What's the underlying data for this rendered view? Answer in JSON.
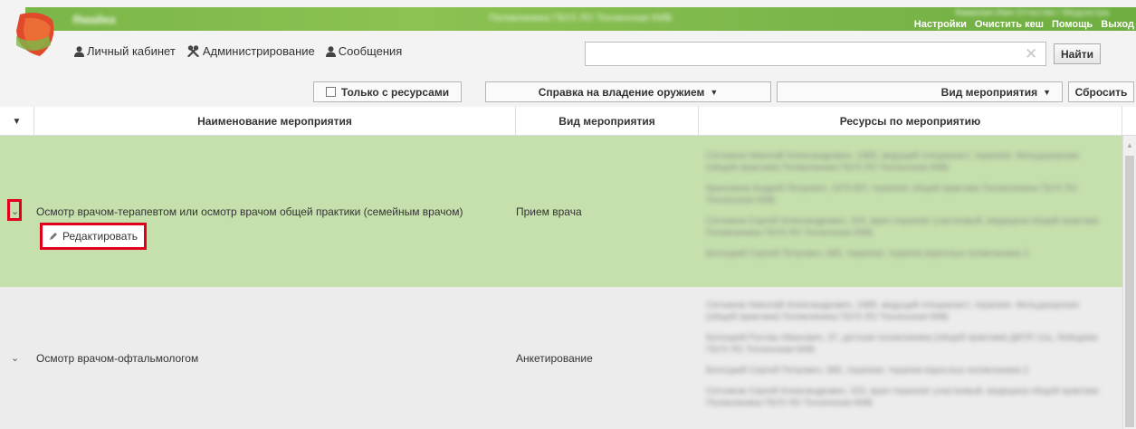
{
  "header": {
    "brand_blurred": "Ямайка",
    "center_blurred": "Поликлиника ГБУЗ ЛО Тосненская КМБ",
    "user_blurred": "Фамилия Имя Отчество / Медсестра",
    "links": [
      "Настройки",
      "Очистить кеш",
      "Помощь",
      "Выход"
    ]
  },
  "nav": {
    "cabinet": "Личный кабинет",
    "admin": "Администрирование",
    "messages": "Сообщения"
  },
  "search": {
    "value": "",
    "placeholder": "",
    "button": "Найти"
  },
  "filters": {
    "resources_only": "Только с ресурсами",
    "certificate": "Справка на владение оружием",
    "event_type": "Вид мероприятия",
    "reset": "Сбросить"
  },
  "table": {
    "columns": [
      "Наименование мероприятия",
      "Вид мероприятия",
      "Ресурсы по мероприятию"
    ],
    "rows": [
      {
        "name": "Осмотр врачом-терапевтом или осмотр врачом общей практики (семейным врачом)",
        "type": "Прием врача",
        "edit_label": "Редактировать",
        "resources_blurred": [
          "Ситников Николай Александрович, 1985, ведущий специалист, терапевт. Фельдшерская (общей практики) Поликлиника ГБУЗ ЛО Тосненская КМБ",
          "Красников Андрей Петрович, 1970 ВП, терапевт общей практики Поликлиника ГБУЗ ЛО Тосненская КМБ",
          "Ситников Сергей Александрович, 315, врач-терапевт участковый, медицина общей практики Поликлиника ГБУЗ ЛО Тосненская КМБ",
          "Белоцкий Сергей Петрович, 085, терапевт, терапия взрослых поликлиника 2"
        ]
      },
      {
        "name": "Осмотр врачом-офтальмологом",
        "type": "Анкетирование",
        "resources_blurred": [
          "Ситников Николай Александрович, 1985, ведущий специалист, терапевт. Фельдшерская (общей практики) Поликлиника ГБУЗ ЛО Тосненская КМБ",
          "Белоцкий Руслан Иванович, 37, детская поликлиника (общей практики) ДКПП 11а, Лебедева ГБУЗ ЛО Тосненская КМБ",
          "Белоцкий Сергей Петрович, 085, терапевт, терапия взрослых поликлиника 2",
          "Ситников Сергей Александрович, 315, врач-терапевт участковый, медицина общей практики Поликлиника ГБУЗ ЛО Тосненская КМБ"
        ]
      }
    ]
  },
  "colors": {
    "header_green": "#7ab648",
    "selected_row": "#c5dfad",
    "highlight_red": "#e0001b"
  }
}
